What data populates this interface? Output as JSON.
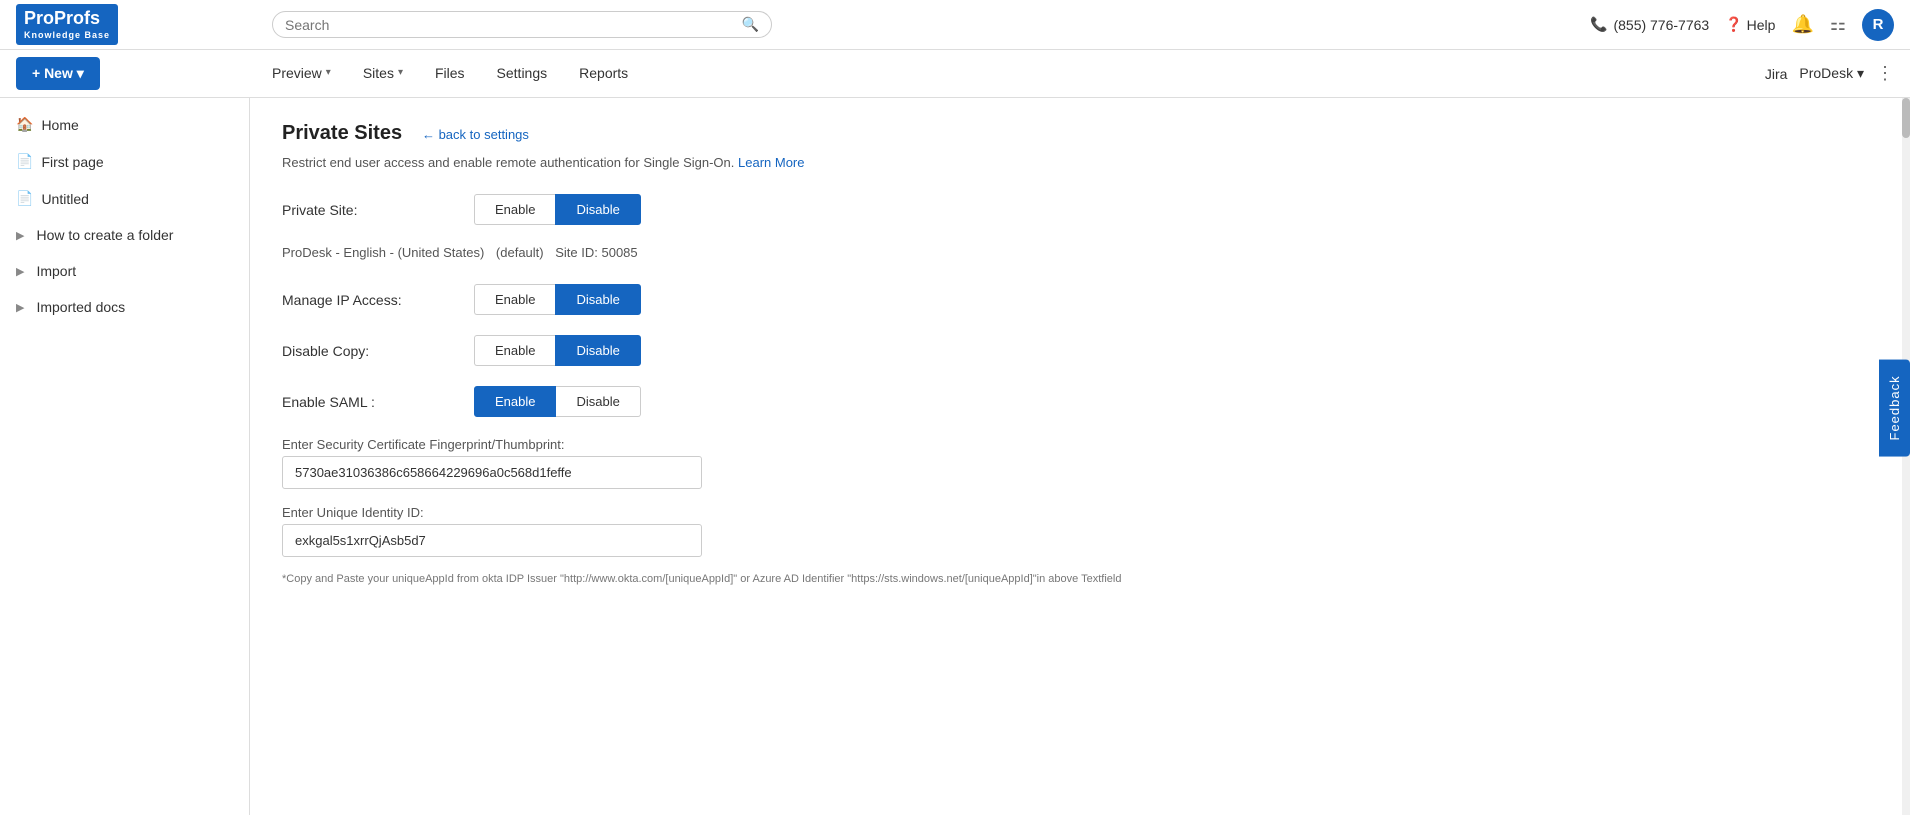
{
  "logo": {
    "brand": "ProProfs",
    "sub": "Knowledge Base"
  },
  "search": {
    "placeholder": "Search"
  },
  "topbar": {
    "phone": "(855) 776-7763",
    "help": "Help",
    "avatar_letter": "R"
  },
  "new_button": "+ New ▾",
  "nav": {
    "items": [
      {
        "label": "Preview",
        "has_chevron": true
      },
      {
        "label": "Sites",
        "has_chevron": true
      },
      {
        "label": "Files",
        "has_chevron": false
      },
      {
        "label": "Settings",
        "has_chevron": false
      },
      {
        "label": "Reports",
        "has_chevron": false
      }
    ],
    "right_links": [
      "Jira",
      "ProDesk ▾",
      "⋮"
    ]
  },
  "sidebar": {
    "items": [
      {
        "label": "Home",
        "icon": "🏠",
        "has_chevron": false
      },
      {
        "label": "First page",
        "icon": "📄",
        "has_chevron": false
      },
      {
        "label": "Untitled",
        "icon": "📄",
        "has_chevron": false
      },
      {
        "label": "How to create a folder",
        "icon": ">",
        "has_chevron": true
      },
      {
        "label": "Import",
        "icon": ">",
        "has_chevron": true
      },
      {
        "label": "Imported docs",
        "icon": ">",
        "has_chevron": true
      }
    ]
  },
  "content": {
    "title": "Private Sites",
    "back_link": "← back to settings",
    "description": "Restrict end user access and enable remote authentication for Single Sign-On.",
    "learn_more": "Learn More",
    "site_info": {
      "name": "ProDesk - English - (United States)",
      "status": "(default)",
      "site_id": "Site ID: 50085"
    },
    "settings": [
      {
        "label": "Private Site:",
        "enable_active": false,
        "disable_active": true
      },
      {
        "label": "Manage IP Access:",
        "enable_active": false,
        "disable_active": true
      },
      {
        "label": "Disable Copy:",
        "enable_active": false,
        "disable_active": true
      },
      {
        "label": "Enable SAML :",
        "enable_active": true,
        "disable_active": false
      }
    ],
    "saml_fields": [
      {
        "label": "Enter Security Certificate Fingerprint/Thumbprint:",
        "value": "5730ae31036386c658664229696a0c568d1feffe"
      },
      {
        "label": "Enter Unique Identity ID:",
        "value": "exkgal5s1xrrQjAsb5d7"
      }
    ],
    "saml_note": "*Copy and Paste your uniqueAppId from okta IDP Issuer \"http://www.okta.com/[uniqueAppId]\" or Azure AD Identifier \"https://sts.windows.net/[uniqueAppId]\"in above Textfield"
  },
  "feedback": "Feedback",
  "buttons": {
    "enable": "Enable",
    "disable": "Disable"
  }
}
